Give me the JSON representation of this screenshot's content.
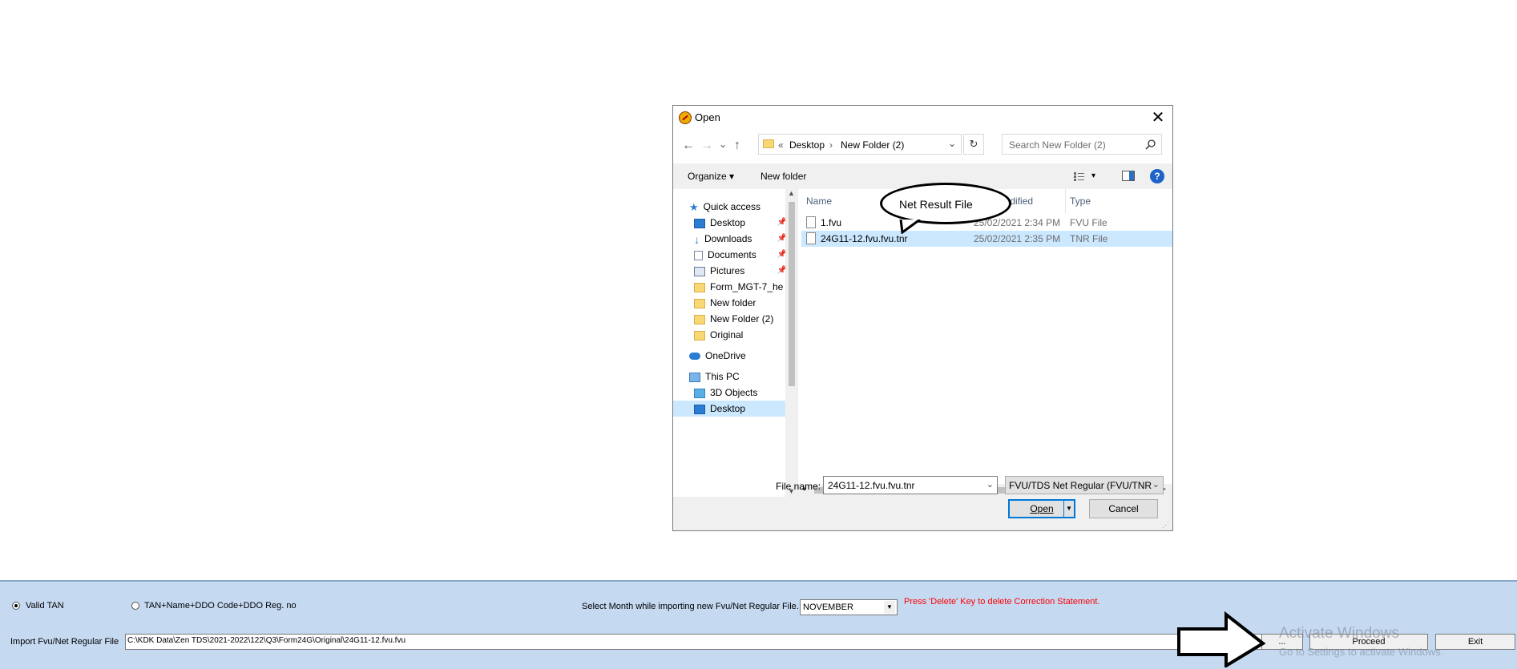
{
  "dialog": {
    "title": "Open",
    "close": "✕",
    "nav": {
      "back": "←",
      "forward": "→",
      "recent": "⌄",
      "up": "↑"
    },
    "breadcrumb": {
      "prefix": "«",
      "items": [
        "Desktop",
        "New Folder (2)"
      ],
      "sep": "›",
      "dropdown": "⌄"
    },
    "refresh": "↻",
    "search_placeholder": "Search New Folder (2)",
    "toolbar": {
      "organize": "Organize ▾",
      "new_folder": "New folder",
      "view": "▾"
    },
    "nav_pane": [
      {
        "label": "Quick access",
        "icon": "star-icon",
        "pinned": false,
        "level": 0
      },
      {
        "label": "Desktop",
        "icon": "desktop-icon",
        "pinned": true,
        "level": 1
      },
      {
        "label": "Downloads",
        "icon": "download-icon",
        "pinned": true,
        "level": 1
      },
      {
        "label": "Documents",
        "icon": "documents-icon",
        "pinned": true,
        "level": 1
      },
      {
        "label": "Pictures",
        "icon": "pictures-icon",
        "pinned": true,
        "level": 1
      },
      {
        "label": "Form_MGT-7_he",
        "icon": "folder-icon",
        "pinned": false,
        "level": 1
      },
      {
        "label": "New folder",
        "icon": "folder-icon",
        "pinned": false,
        "level": 1
      },
      {
        "label": "New Folder (2)",
        "icon": "folder-icon",
        "pinned": false,
        "level": 1
      },
      {
        "label": "Original",
        "icon": "folder-icon",
        "pinned": false,
        "level": 1
      },
      {
        "label": "OneDrive",
        "icon": "cloud-icon",
        "pinned": false,
        "level": 0
      },
      {
        "label": "This PC",
        "icon": "pc-icon",
        "pinned": false,
        "level": 0
      },
      {
        "label": "3D Objects",
        "icon": "cube-icon",
        "pinned": false,
        "level": 1
      },
      {
        "label": "Desktop",
        "icon": "desktop-icon",
        "pinned": false,
        "level": 1,
        "selected": true
      }
    ],
    "columns": {
      "name": "Name",
      "date": "Date modified",
      "type": "Type"
    },
    "files": [
      {
        "name": "1.fvu",
        "date": "25/02/2021 2:34 PM",
        "type": "FVU File",
        "selected": false
      },
      {
        "name": "24G11-12.fvu.fvu.tnr",
        "date": "25/02/2021 2:35 PM",
        "type": "TNR File",
        "selected": true
      }
    ],
    "file_name_label": "File name:",
    "file_name_value": "24G11-12.fvu.fvu.tnr",
    "file_type_value": "FVU/TDS Net Regular (FVU/TNR",
    "open_label": "Open",
    "cancel_label": "Cancel"
  },
  "callout_text": "Net Result File",
  "panel": {
    "radio1": "Valid TAN",
    "radio2": "TAN+Name+DDO Code+DDO Reg. no",
    "month_label": "Select Month while importing new Fvu/Net Regular File.",
    "month_value": "NOVEMBER",
    "delete_hint": "Press 'Delete' Key to delete Correction Statement.",
    "import_label": "Import Fvu/Net Regular File",
    "import_path": "C:\\KDK Data\\Zen TDS\\2021-2022\\122\\Q3\\Form24G\\Original\\24G11-12.fvu.fvu",
    "browse_label": "...",
    "proceed_label": "Proceed",
    "exit_label": "Exit",
    "watermark1": "Activate Windows",
    "watermark2": "Go to Settings to activate Windows."
  },
  "colors": {
    "selection": "#cce8ff",
    "panel": "#c5d9f1",
    "hint": "#ff0000",
    "accent": "#0078d7"
  }
}
